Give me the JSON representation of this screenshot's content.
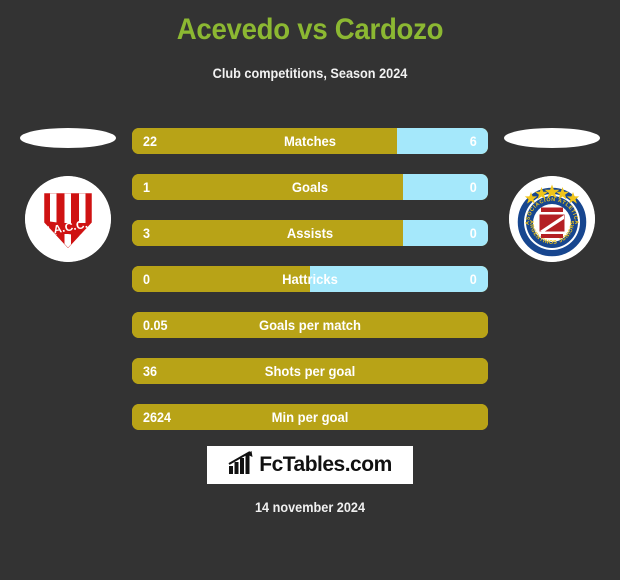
{
  "header": {
    "title": "Acevedo vs Cardozo",
    "subtitle": "Club competitions, Season 2024",
    "title_color": "#8CB832"
  },
  "teams": {
    "home": {
      "crest_name": "instituto-atletico-central-cordoba-crest",
      "crest_initials": "I.A.C.C."
    },
    "away": {
      "crest_name": "argentinos-juniors-crest",
      "crest_line1": "ASOCIACION ATLETICA",
      "crest_line2": "ARGENTINOS JUNIORS"
    }
  },
  "colors": {
    "background": "#333333",
    "home_bar": "#B8A317",
    "away_bar": "#A5E8FB",
    "accent_green": "#8CB832",
    "text_light": "#FFFFFF"
  },
  "footer": {
    "logo_text": "FcTables.com",
    "logo_icon": "bar-chart-arrow-icon",
    "date": "14 november 2024"
  },
  "chart_data": {
    "type": "bar",
    "title": "Acevedo vs Cardozo",
    "subtitle": "Club competitions, Season 2024",
    "orientation": "horizontal-diverging",
    "legend_position": "none",
    "grid": false,
    "series": [
      {
        "name": "Acevedo",
        "color": "#B8A317",
        "side": "left"
      },
      {
        "name": "Cardozo",
        "color": "#A5E8FB",
        "side": "right"
      }
    ],
    "categories": [
      "Matches",
      "Goals",
      "Assists",
      "Hattricks",
      "Goals per match",
      "Shots per goal",
      "Min per goal"
    ],
    "rows": [
      {
        "label": "Matches",
        "home": "22",
        "away": "6",
        "home_pct": 74.5,
        "away_pct": 25.5,
        "has_away": true
      },
      {
        "label": "Goals",
        "home": "1",
        "away": "0",
        "home_pct": 76,
        "away_pct": 24,
        "has_away": true
      },
      {
        "label": "Assists",
        "home": "3",
        "away": "0",
        "home_pct": 76,
        "away_pct": 24,
        "has_away": true
      },
      {
        "label": "Hattricks",
        "home": "0",
        "away": "0",
        "home_pct": 50,
        "away_pct": 50,
        "has_away": true
      },
      {
        "label": "Goals per match",
        "home": "0.05",
        "away": "",
        "home_pct": 100,
        "away_pct": 0,
        "has_away": false
      },
      {
        "label": "Shots per goal",
        "home": "36",
        "away": "",
        "home_pct": 100,
        "away_pct": 0,
        "has_away": false
      },
      {
        "label": "Min per goal",
        "home": "2624",
        "away": "",
        "home_pct": 100,
        "away_pct": 0,
        "has_away": false
      }
    ]
  }
}
